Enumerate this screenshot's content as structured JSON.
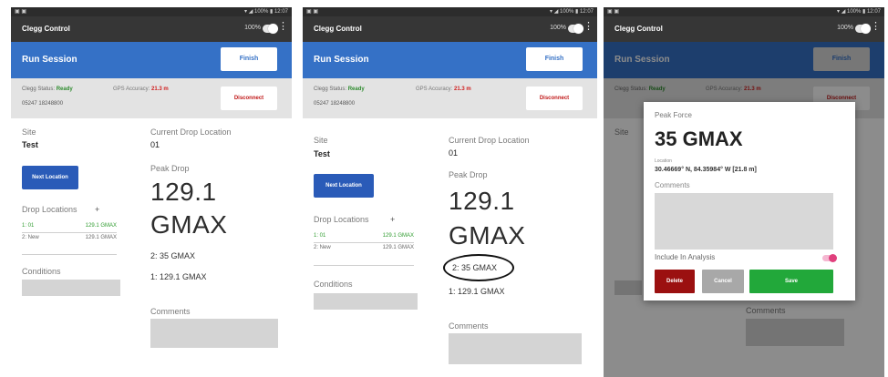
{
  "status_bar": {
    "left": "▣ ▣",
    "right": "▾ ◢ 100% ▮ 12:07"
  },
  "app": {
    "title": "Clegg Control",
    "battery": "100%"
  },
  "run_session": {
    "title": "Run Session",
    "finish_label": "Finish"
  },
  "device": {
    "status_label": "Clegg Status:",
    "status_value": "Ready",
    "id": "05247 18248800",
    "gps_label": "GPS Accuracy:",
    "gps_value": "21.3 m",
    "disconnect_label": "Disconnect"
  },
  "site": {
    "label": "Site",
    "value": "Test"
  },
  "drop_location": {
    "label": "Current Drop Location",
    "value": "01"
  },
  "next_location_label": "Next Location",
  "peak_drop": {
    "label": "Peak Drop",
    "line1": "129.1",
    "line2": "GMAX"
  },
  "drop_locations": {
    "title": "Drop Locations",
    "add": "+",
    "items": [
      {
        "name": "1: 01",
        "value": "129.1 GMAX",
        "color": "#2e9b2e"
      },
      {
        "name": "2: New",
        "value": "129.1 GMAX",
        "color": "#666666"
      }
    ]
  },
  "drops": [
    "2: 35 GMAX",
    "1: 129.1 GMAX"
  ],
  "conditions_label": "Conditions",
  "comments_label": "Comments",
  "dialog": {
    "title": "Peak Force",
    "value": "35 GMAX",
    "location_label": "Location",
    "location": "30.46669° N, 84.35984° W [21.8 m]",
    "comments_label": "Comments",
    "include_label": "Include In Analysis",
    "delete_label": "Delete",
    "cancel_label": "Cancel",
    "save_label": "Save"
  },
  "colors": {
    "appbar": "#363636",
    "blue": "#3571c6",
    "ready": "#2e8b2e",
    "alert": "#d02020",
    "save": "#22a83a",
    "delete": "#9b1010"
  }
}
